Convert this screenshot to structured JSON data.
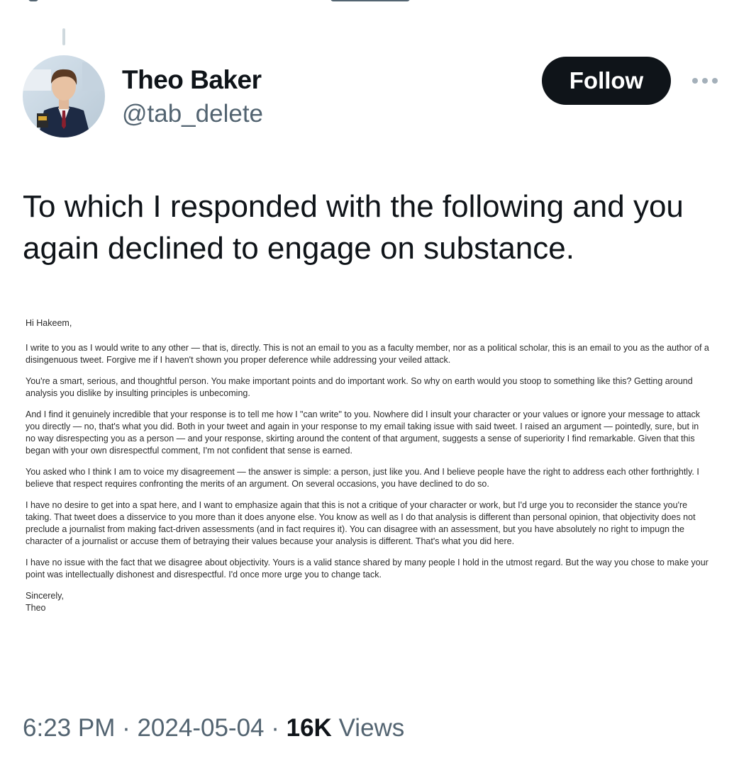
{
  "author": {
    "name": "Theo Baker",
    "handle": "@tab_delete",
    "follow_label": "Follow"
  },
  "tweet": {
    "text": "To which I responded with the following and you again declined to engage on substance."
  },
  "letter": {
    "greeting": "Hi Hakeem,",
    "paragraphs": [
      "I write to you as I would write to any other — that is, directly. This is not an email to you as a faculty member, nor as a political scholar, this is an email to you as the author of a disingenuous tweet. Forgive me if I haven't shown you proper deference while addressing your veiled attack.",
      "You're a smart, serious, and thoughtful person. You make important points and do important work. So why on earth would you stoop to something like this? Getting around analysis you dislike by insulting principles is unbecoming.",
      "And I find it genuinely incredible that your response is to tell me how I \"can write\" to you. Nowhere did I insult your character or your values or ignore your message to attack you directly — no, that's what you did. Both in your tweet and again in your response to my email taking issue with said tweet. I raised an argument — pointedly, sure, but in no way disrespecting you as a person — and your response, skirting around the content of that argument, suggests a sense of superiority I find remarkable. Given that this began with your own disrespectful comment, I'm not confident that sense is earned.",
      "You asked who I think I am to voice my disagreement — the answer is simple: a person, just like you. And I believe people have the right to address each other forthrightly. I believe that respect requires confronting the merits of an argument. On several occasions, you have declined to do so.",
      "I have no desire to get into a spat here, and I want to emphasize again that this is not a critique of your character or work, but I'd urge you to reconsider the stance you're taking. That tweet does a disservice to you more than it does anyone else. You know as well as I do that analysis is different than personal opinion, that objectivity does not preclude a journalist from making fact-driven assessments (and in fact requires it). You can disagree with an assessment, but you have absolutely no right to impugn the character of a journalist or accuse them of betraying their values because your analysis is different. That's what you did here.",
      "I have no issue with the fact that we disagree about objectivity. Yours is a valid stance shared by many people I hold in the utmost regard. But the way you chose to make your point was intellectually dishonest and disrespectful. I'd once more urge you to change tack."
    ],
    "signoff": "Sincerely,",
    "signature": "Theo"
  },
  "meta": {
    "time": "6:23 PM",
    "separator": " · ",
    "date": "2024-05-04",
    "views_count": "16K",
    "views_label": "Views"
  },
  "icons": {
    "avatar": "profile-photo",
    "more": "more-options-icon"
  },
  "colors": {
    "text_primary": "#0f1419",
    "text_secondary": "#536471",
    "button_bg": "#0f1419",
    "button_text": "#ffffff"
  }
}
